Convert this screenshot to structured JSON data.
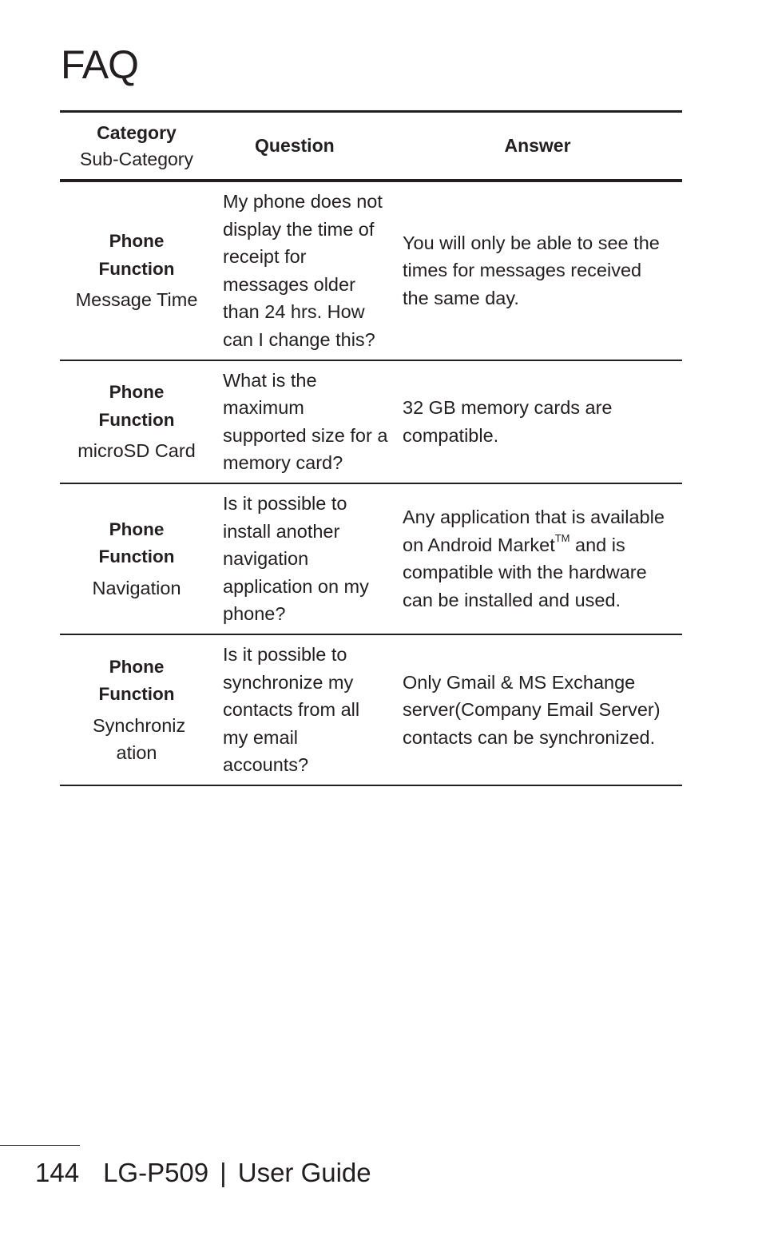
{
  "page": {
    "title": "FAQ"
  },
  "table": {
    "headers": {
      "category": "Category",
      "sub_category": "Sub-Category",
      "question": "Question",
      "answer": "Answer"
    },
    "rows": [
      {
        "category": "Phone Function",
        "sub_category": "Message Time",
        "question": "My phone does not display the time of receipt for messages older than 24 hrs. How can I change this?",
        "answer": "You will only be able to see the times for messages received the same day."
      },
      {
        "category": "Phone Function",
        "sub_category": "microSD Card",
        "question": "What is the maximum supported size for a memory card?",
        "answer": "32 GB memory cards are compatible."
      },
      {
        "category": "Phone Function",
        "sub_category": "Navigation",
        "question": "Is it possible to install another navigation application on my phone?",
        "answer_pre": "Any application that is available on Android Market",
        "answer_sup": "TM",
        "answer_post": " and is compatible with the hardware can be installed and used."
      },
      {
        "category": "Phone Function",
        "sub_category": "Synchroniz ation",
        "question": "Is it possible to synchronize my contacts from all my email accounts?",
        "answer": "Only Gmail & MS Exchange server(Company Email Server) contacts can be synchronized."
      }
    ]
  },
  "footer": {
    "page_number": "144",
    "model": "LG-P509",
    "separator": "|",
    "guide": "User Guide"
  }
}
